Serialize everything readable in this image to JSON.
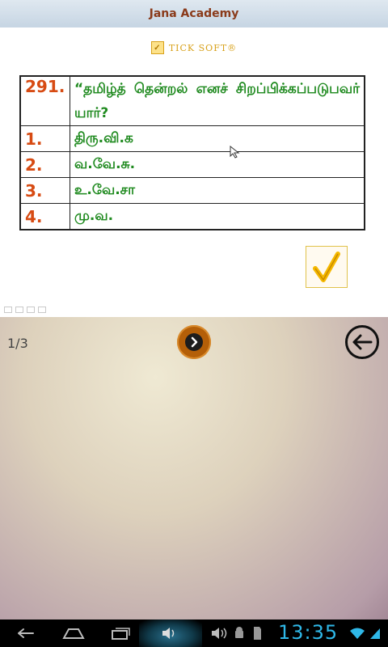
{
  "app": {
    "title": "Jana Academy",
    "brand": "TICK SOFT®",
    "brand_logo_glyph": "✓"
  },
  "question": {
    "number": "291.",
    "text": "“தமிழ்த் தென்றல் எனச் சிறப்பிக்கப்படுபவர் யார்?",
    "options": [
      {
        "number": "1.",
        "text": "திரு.வி.க"
      },
      {
        "number": "2.",
        "text": "வ.வே.சு."
      },
      {
        "number": "3.",
        "text": "உ.வே.சா"
      },
      {
        "number": "4.",
        "text": "மு.வ."
      }
    ]
  },
  "pager": {
    "current": "1/3"
  },
  "statusbar": {
    "time": "13:35"
  },
  "colors": {
    "number": "#d74b13",
    "text": "#1f8a1f",
    "accent_next": "#b45f08",
    "clock": "#2fb8e8"
  }
}
